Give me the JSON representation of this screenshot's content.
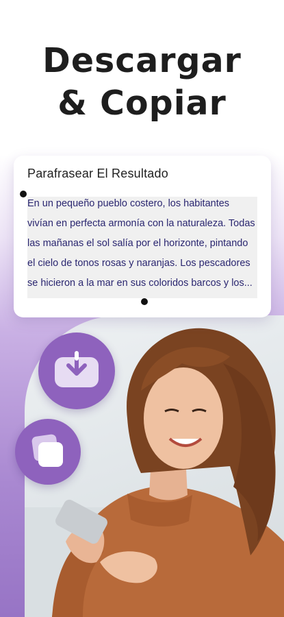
{
  "headline": {
    "line1": "Descargar",
    "line2": "& Copiar"
  },
  "result_card": {
    "title": "Parafrasear El Resultado",
    "text": "En un pequeño pueblo costero, los habitantes vivían en perfecta armonía con la naturaleza. Todas las mañanas el sol salía por el horizonte, pintando el cielo de tonos rosas y naranjas. Los pescadores se hicieron a la mar en sus coloridos barcos y los..."
  },
  "actions": {
    "download_icon": "download-icon",
    "copy_icon": "copy-icon"
  },
  "colors": {
    "accent": "#8e62bd",
    "headline": "#1e1e1e",
    "card_text": "#2a2670"
  }
}
